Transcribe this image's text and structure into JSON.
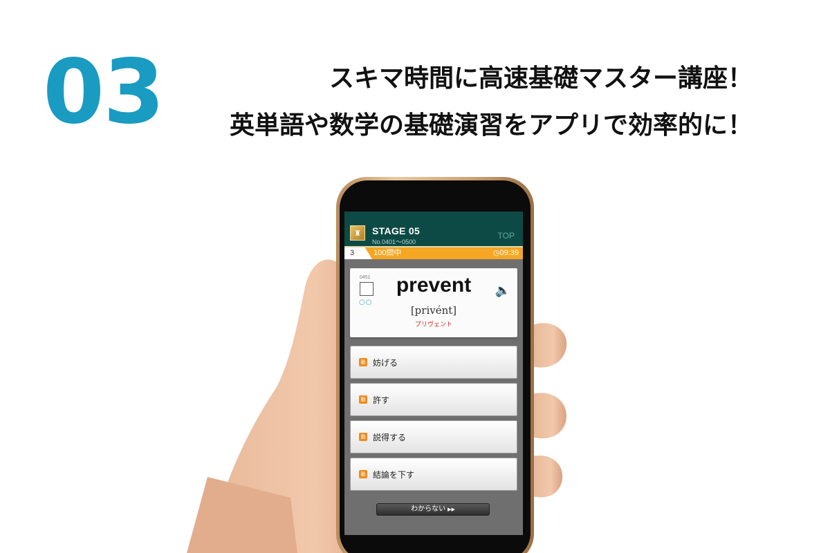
{
  "promo": {
    "number": "03",
    "line1": "スキマ時間に高速基礎マスター講座！",
    "line2": "英単語や数学の基礎演習をアプリで効率的に！"
  },
  "app": {
    "stage_title": "STAGE 05",
    "stage_range": "No.0401〜0500",
    "top_link": "TOP",
    "question_number": "3",
    "question_total": "100問中",
    "timer": "09:39",
    "word_id": "0451",
    "word": "prevent",
    "pronunciation": "[privént]",
    "katakana": "プリヴェント",
    "answers": [
      {
        "label": "妨げる",
        "icon": "verb-icon"
      },
      {
        "label": "許す",
        "icon": "verb-icon"
      },
      {
        "label": "説得する",
        "icon": "verb-icon"
      },
      {
        "label": "結論を下す",
        "icon": "verb-icon"
      }
    ],
    "dont_know_label": "わからない"
  },
  "colors": {
    "accent_number": "#1a9bc2",
    "header_bg": "#0e4a45",
    "progress_bar": "#f5a623",
    "answer_icon": "#f08a1c",
    "katakana": "#d0261c"
  }
}
